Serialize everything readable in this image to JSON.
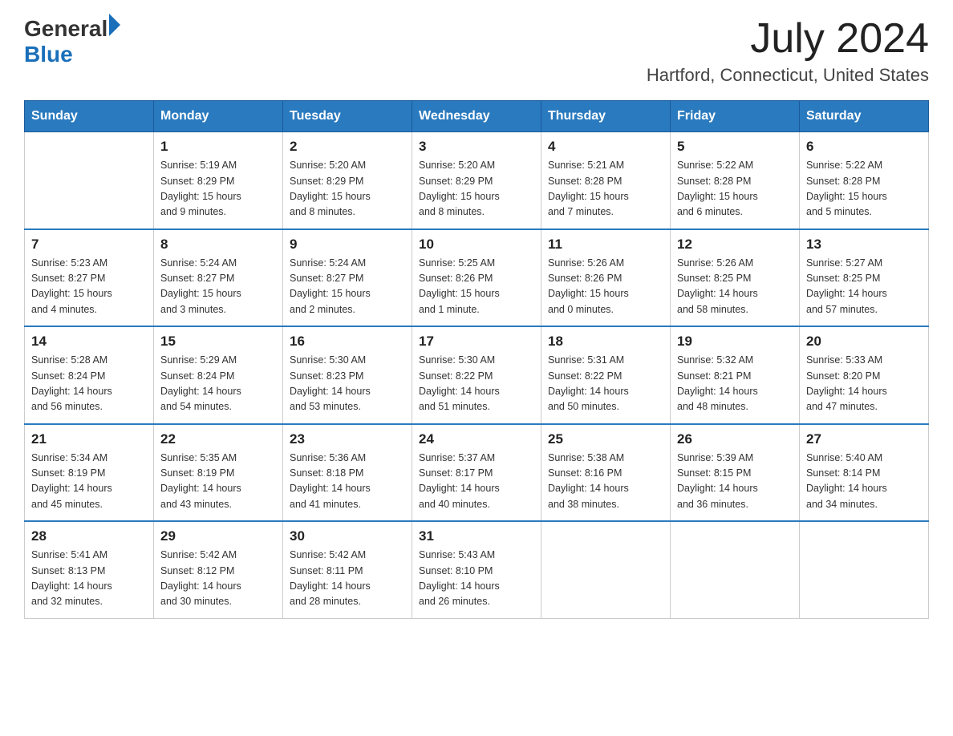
{
  "header": {
    "logo_general": "General",
    "logo_blue": "Blue",
    "month_year": "July 2024",
    "location": "Hartford, Connecticut, United States"
  },
  "weekdays": [
    "Sunday",
    "Monday",
    "Tuesday",
    "Wednesday",
    "Thursday",
    "Friday",
    "Saturday"
  ],
  "weeks": [
    [
      {
        "day": "",
        "info": ""
      },
      {
        "day": "1",
        "info": "Sunrise: 5:19 AM\nSunset: 8:29 PM\nDaylight: 15 hours\nand 9 minutes."
      },
      {
        "day": "2",
        "info": "Sunrise: 5:20 AM\nSunset: 8:29 PM\nDaylight: 15 hours\nand 8 minutes."
      },
      {
        "day": "3",
        "info": "Sunrise: 5:20 AM\nSunset: 8:29 PM\nDaylight: 15 hours\nand 8 minutes."
      },
      {
        "day": "4",
        "info": "Sunrise: 5:21 AM\nSunset: 8:28 PM\nDaylight: 15 hours\nand 7 minutes."
      },
      {
        "day": "5",
        "info": "Sunrise: 5:22 AM\nSunset: 8:28 PM\nDaylight: 15 hours\nand 6 minutes."
      },
      {
        "day": "6",
        "info": "Sunrise: 5:22 AM\nSunset: 8:28 PM\nDaylight: 15 hours\nand 5 minutes."
      }
    ],
    [
      {
        "day": "7",
        "info": "Sunrise: 5:23 AM\nSunset: 8:27 PM\nDaylight: 15 hours\nand 4 minutes."
      },
      {
        "day": "8",
        "info": "Sunrise: 5:24 AM\nSunset: 8:27 PM\nDaylight: 15 hours\nand 3 minutes."
      },
      {
        "day": "9",
        "info": "Sunrise: 5:24 AM\nSunset: 8:27 PM\nDaylight: 15 hours\nand 2 minutes."
      },
      {
        "day": "10",
        "info": "Sunrise: 5:25 AM\nSunset: 8:26 PM\nDaylight: 15 hours\nand 1 minute."
      },
      {
        "day": "11",
        "info": "Sunrise: 5:26 AM\nSunset: 8:26 PM\nDaylight: 15 hours\nand 0 minutes."
      },
      {
        "day": "12",
        "info": "Sunrise: 5:26 AM\nSunset: 8:25 PM\nDaylight: 14 hours\nand 58 minutes."
      },
      {
        "day": "13",
        "info": "Sunrise: 5:27 AM\nSunset: 8:25 PM\nDaylight: 14 hours\nand 57 minutes."
      }
    ],
    [
      {
        "day": "14",
        "info": "Sunrise: 5:28 AM\nSunset: 8:24 PM\nDaylight: 14 hours\nand 56 minutes."
      },
      {
        "day": "15",
        "info": "Sunrise: 5:29 AM\nSunset: 8:24 PM\nDaylight: 14 hours\nand 54 minutes."
      },
      {
        "day": "16",
        "info": "Sunrise: 5:30 AM\nSunset: 8:23 PM\nDaylight: 14 hours\nand 53 minutes."
      },
      {
        "day": "17",
        "info": "Sunrise: 5:30 AM\nSunset: 8:22 PM\nDaylight: 14 hours\nand 51 minutes."
      },
      {
        "day": "18",
        "info": "Sunrise: 5:31 AM\nSunset: 8:22 PM\nDaylight: 14 hours\nand 50 minutes."
      },
      {
        "day": "19",
        "info": "Sunrise: 5:32 AM\nSunset: 8:21 PM\nDaylight: 14 hours\nand 48 minutes."
      },
      {
        "day": "20",
        "info": "Sunrise: 5:33 AM\nSunset: 8:20 PM\nDaylight: 14 hours\nand 47 minutes."
      }
    ],
    [
      {
        "day": "21",
        "info": "Sunrise: 5:34 AM\nSunset: 8:19 PM\nDaylight: 14 hours\nand 45 minutes."
      },
      {
        "day": "22",
        "info": "Sunrise: 5:35 AM\nSunset: 8:19 PM\nDaylight: 14 hours\nand 43 minutes."
      },
      {
        "day": "23",
        "info": "Sunrise: 5:36 AM\nSunset: 8:18 PM\nDaylight: 14 hours\nand 41 minutes."
      },
      {
        "day": "24",
        "info": "Sunrise: 5:37 AM\nSunset: 8:17 PM\nDaylight: 14 hours\nand 40 minutes."
      },
      {
        "day": "25",
        "info": "Sunrise: 5:38 AM\nSunset: 8:16 PM\nDaylight: 14 hours\nand 38 minutes."
      },
      {
        "day": "26",
        "info": "Sunrise: 5:39 AM\nSunset: 8:15 PM\nDaylight: 14 hours\nand 36 minutes."
      },
      {
        "day": "27",
        "info": "Sunrise: 5:40 AM\nSunset: 8:14 PM\nDaylight: 14 hours\nand 34 minutes."
      }
    ],
    [
      {
        "day": "28",
        "info": "Sunrise: 5:41 AM\nSunset: 8:13 PM\nDaylight: 14 hours\nand 32 minutes."
      },
      {
        "day": "29",
        "info": "Sunrise: 5:42 AM\nSunset: 8:12 PM\nDaylight: 14 hours\nand 30 minutes."
      },
      {
        "day": "30",
        "info": "Sunrise: 5:42 AM\nSunset: 8:11 PM\nDaylight: 14 hours\nand 28 minutes."
      },
      {
        "day": "31",
        "info": "Sunrise: 5:43 AM\nSunset: 8:10 PM\nDaylight: 14 hours\nand 26 minutes."
      },
      {
        "day": "",
        "info": ""
      },
      {
        "day": "",
        "info": ""
      },
      {
        "day": "",
        "info": ""
      }
    ]
  ]
}
